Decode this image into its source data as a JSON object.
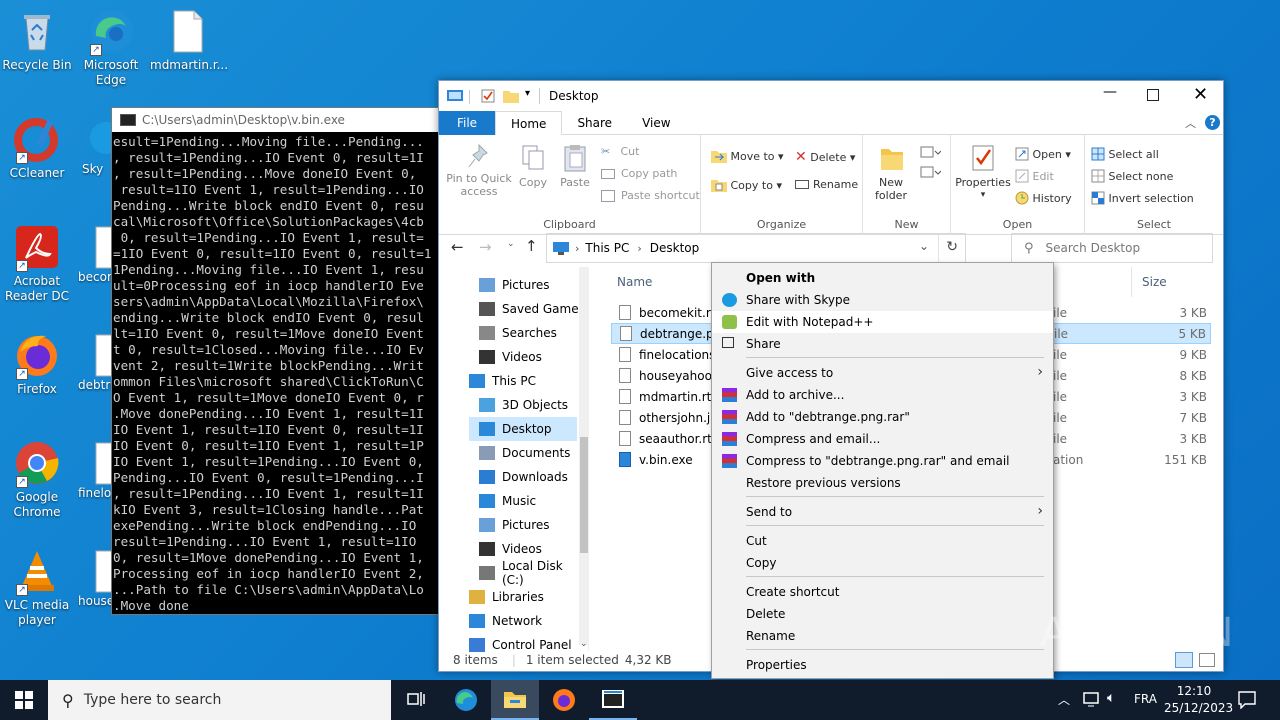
{
  "desktop": {
    "icons": [
      {
        "label": "Recycle Bin"
      },
      {
        "label": "Microsoft Edge"
      },
      {
        "label": "mdmartin.r..."
      },
      {
        "label": "CCleaner"
      },
      {
        "label": "Sky"
      },
      {
        "label": "Acrobat Reader DC"
      },
      {
        "label": "becom"
      },
      {
        "label": "Firefox"
      },
      {
        "label": "debtra"
      },
      {
        "label": "Google Chrome"
      },
      {
        "label": "finelo"
      },
      {
        "label": "VLC media player"
      },
      {
        "label": "house"
      }
    ]
  },
  "console": {
    "title": "C:\\Users\\admin\\Desktop\\v.bin.exe",
    "lines": [
      "esult=1Pending...Moving file...Pending...",
      ", result=1Pending...IO Event 0, result=1I",
      ", result=1Pending...Move doneIO Event 0,",
      " result=1IO Event 1, result=1Pending...IO",
      "Pending...Write block endIO Event 0, resu",
      "cal\\Microsoft\\Office\\SolutionPackages\\4cb",
      " 0, result=1Pending...IO Event 1, result=",
      "=1IO Event 0, result=1IO Event 0, result=1",
      "1Pending...Moving file...IO Event 1, resu",
      "ult=0Processing eof in iocp handlerIO Eve",
      "sers\\admin\\AppData\\Local\\Mozilla\\Firefox\\",
      "ending...Write block endIO Event 0, resul",
      "lt=1IO Event 0, result=1Move doneIO Event",
      "t 0, result=1Closed...Moving file...IO Ev",
      "vent 2, result=1Write blockPending...Writ",
      "ommon Files\\microsoft shared\\ClickToRun\\C",
      "O Event 1, result=1Move doneIO Event 0, r",
      ".Move donePending...IO Event 1, result=1I",
      "IO Event 1, result=1IO Event 0, result=1I",
      "IO Event 0, result=1IO Event 1, result=1P",
      "IO Event 1, result=1Pending...IO Event 0,",
      "Pending...IO Event 0, result=1Pending...I",
      ", result=1Pending...IO Event 1, result=1I",
      "kIO Event 3, result=1Closing handle...Pat",
      "exePending...Write block endPending...IO ",
      "result=1Pending...IO Event 1, result=1IO ",
      "0, result=1Move donePending...IO Event 1,",
      "Processing eof in iocp handlerIO Event 2,",
      "...Path to file C:\\Users\\admin\\AppData\\Lo",
      ".Move done"
    ]
  },
  "explorer": {
    "title": "Desktop",
    "tabs": [
      "File",
      "Home",
      "Share",
      "View"
    ],
    "ribbon": {
      "clipboard": {
        "label": "Clipboard",
        "pin": "Pin to Quick access",
        "copy": "Copy",
        "paste": "Paste",
        "cut": "Cut",
        "copy_path": "Copy path",
        "paste_shortcut": "Paste shortcut"
      },
      "organize": {
        "label": "Organize",
        "move_to": "Move to",
        "copy_to": "Copy to",
        "delete": "Delete",
        "rename": "Rename"
      },
      "new": {
        "label": "New",
        "new_folder": "New folder"
      },
      "open": {
        "label": "Open",
        "properties": "Properties",
        "open": "Open",
        "edit": "Edit",
        "history": "History"
      },
      "select": {
        "label": "Select",
        "select_all": "Select all",
        "select_none": "Select none",
        "invert": "Invert selection"
      }
    },
    "address": {
      "crumbs": [
        "This PC",
        "Desktop"
      ],
      "search_placeholder": "Search Desktop"
    },
    "nav": [
      "Pictures",
      "Saved Games",
      "Searches",
      "Videos",
      "This PC",
      "3D Objects",
      "Desktop",
      "Documents",
      "Downloads",
      "Music",
      "Pictures",
      "Videos",
      "Local Disk (C:)",
      "Libraries",
      "Network",
      "Control Panel"
    ],
    "columns": {
      "name": "Name",
      "size": "Size"
    },
    "files": [
      {
        "name": "becomekit.rtf...",
        "type": "ile",
        "size": "3 KB"
      },
      {
        "name": "debtrange.png",
        "type": "ile",
        "size": "5 KB"
      },
      {
        "name": "finelocations.j",
        "type": "ile",
        "size": "9 KB"
      },
      {
        "name": "houseyahoo.p",
        "type": "ile",
        "size": "8 KB"
      },
      {
        "name": "mdmartin.rtf.E",
        "type": "ile",
        "size": "3 KB"
      },
      {
        "name": "othersjohn.jpg",
        "type": "ile",
        "size": "7 KB"
      },
      {
        "name": "seaauthor.rtf.E",
        "type": "ile",
        "size": "3 KB"
      },
      {
        "name": "v.bin.exe",
        "type": "ation",
        "size": "151 KB"
      }
    ],
    "status": {
      "items": "8 items",
      "selected": "1 item selected",
      "size": "4,32 KB"
    }
  },
  "context_menu": {
    "items": [
      "Open with",
      "Share with Skype",
      "Edit with Notepad++",
      "Share",
      "Give access to",
      "Add to archive...",
      "Add to \"debtrange.png.rar\"",
      "Compress and email...",
      "Compress to \"debtrange.png.rar\" and email",
      "Restore previous versions",
      "Send to",
      "Cut",
      "Copy",
      "Create shortcut",
      "Delete",
      "Rename",
      "Properties"
    ]
  },
  "taskbar": {
    "search_placeholder": "Type here to search",
    "lang": "FRA",
    "time": "12:10",
    "date": "25/12/2023"
  },
  "watermark": "ANY RUN"
}
